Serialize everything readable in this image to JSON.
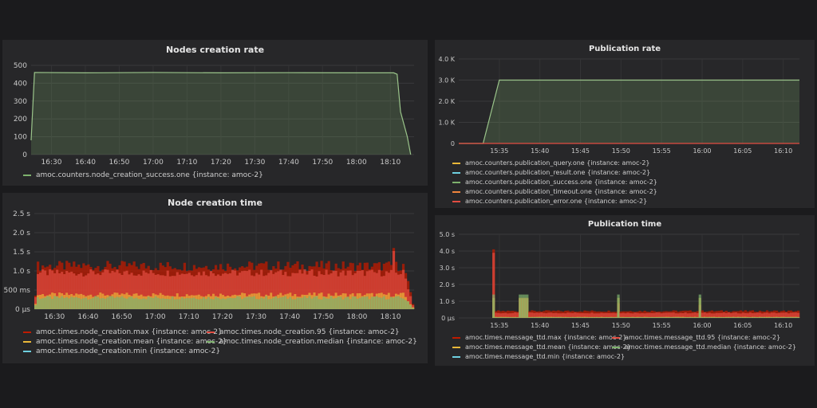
{
  "panels": {
    "p1": {
      "title": "Nodes creation rate",
      "legend": [
        {
          "label": "amoc.counters.node_creation_success.one {instance: amoc-2}",
          "color": "#7eb26d"
        }
      ]
    },
    "p2": {
      "title": "Node creation time",
      "legend": [
        {
          "label": "amoc.times.node_creation.max {instance: amoc-2}",
          "color": "#bf1b00"
        },
        {
          "label": "amoc.times.node_creation.95 {instance: amoc-2}",
          "color": "#e24d42"
        },
        {
          "label": "amoc.times.node_creation.mean {instance: amoc-2}",
          "color": "#eab839"
        },
        {
          "label": "amoc.times.node_creation.median {instance: amoc-2}",
          "color": "#7eb26d"
        },
        {
          "label": "amoc.times.node_creation.min {instance: amoc-2}",
          "color": "#6ed0e0"
        }
      ]
    },
    "p3": {
      "title": "Publication rate",
      "legend": [
        {
          "label": "amoc.counters.publication_query.one {instance: amoc-2}",
          "color": "#eab839"
        },
        {
          "label": "amoc.counters.publication_result.one {instance: amoc-2}",
          "color": "#6ed0e0"
        },
        {
          "label": "amoc.counters.publication_success.one {instance: amoc-2}",
          "color": "#7eb26d"
        },
        {
          "label": "amoc.counters.publication_timeout.one {instance: amoc-2}",
          "color": "#ef843c"
        },
        {
          "label": "amoc.counters.publication_error.one {instance: amoc-2}",
          "color": "#e24d42"
        }
      ]
    },
    "p4": {
      "title": "Publication time",
      "legend": [
        {
          "label": "amoc.times.message_ttd.max {instance: amoc-2}",
          "color": "#bf1b00"
        },
        {
          "label": "amoc.times.message_ttd.95 {instance: amoc-2}",
          "color": "#e24d42"
        },
        {
          "label": "amoc.times.message_ttd.mean {instance: amoc-2}",
          "color": "#eab839"
        },
        {
          "label": "amoc.times.message_ttd.median {instance: amoc-2}",
          "color": "#7eb26d"
        },
        {
          "label": "amoc.times.message_ttd.min {instance: amoc-2}",
          "color": "#6ed0e0"
        }
      ]
    }
  },
  "chart_data": [
    {
      "id": "p1",
      "type": "area",
      "title": "Nodes creation rate",
      "x_ticks": [
        "16:30",
        "16:40",
        "16:50",
        "17:00",
        "17:10",
        "17:20",
        "17:30",
        "17:40",
        "17:50",
        "18:00",
        "18:10"
      ],
      "xlim": [
        "16:24",
        "18:17"
      ],
      "y_ticks": [
        "500",
        "400",
        "300",
        "200",
        "100",
        "0"
      ],
      "ylim": [
        0,
        500
      ],
      "grid": true,
      "series": [
        {
          "name": "amoc.counters.node_creation_success.one {instance: amoc-2}",
          "x": [
            "16:24",
            "16:25",
            "16:40",
            "17:00",
            "17:20",
            "17:40",
            "18:00",
            "18:11",
            "18:12",
            "18:13",
            "18:15",
            "18:16"
          ],
          "values": [
            80,
            460,
            458,
            460,
            458,
            459,
            458,
            458,
            450,
            240,
            100,
            0
          ]
        }
      ]
    },
    {
      "id": "p2",
      "type": "bar",
      "title": "Node creation time",
      "x_ticks": [
        "16:30",
        "16:40",
        "16:50",
        "17:00",
        "17:10",
        "17:20",
        "17:30",
        "17:40",
        "17:50",
        "18:00",
        "18:10"
      ],
      "xlim": [
        "16:24",
        "18:17"
      ],
      "y_ticks": [
        "2.5 s",
        "2.0 s",
        "1.5 s",
        "1.0 s",
        "500 ms",
        "0 µs"
      ],
      "ylim": [
        0,
        2.5
      ],
      "grid": true,
      "typical": {
        "max": 1.1,
        "p95": 0.95,
        "mean": 0.38,
        "median": 0.3,
        "min": 0.0
      },
      "spikes": [
        {
          "x": "16:25",
          "max": 2.1
        },
        {
          "x": "18:11",
          "max": 1.6
        }
      ]
    },
    {
      "id": "p3",
      "type": "area",
      "title": "Publication rate",
      "x_ticks": [
        "15:35",
        "15:40",
        "15:45",
        "15:50",
        "15:55",
        "16:00",
        "16:05",
        "16:10"
      ],
      "xlim": [
        "15:30",
        "16:12"
      ],
      "y_ticks": [
        "4.0 K",
        "3.0 K",
        "2.0 K",
        "1.0 K",
        "0"
      ],
      "ylim": [
        0,
        4000
      ],
      "grid": true,
      "series": [
        {
          "name": "amoc.counters.publication_success.one {instance: amoc-2}",
          "x": [
            "15:30",
            "15:33",
            "15:34",
            "15:35",
            "15:40",
            "15:50",
            "16:00",
            "16:12"
          ],
          "values": [
            0,
            0,
            1500,
            3000,
            3000,
            3000,
            3000,
            3000
          ]
        }
      ]
    },
    {
      "id": "p4",
      "type": "bar",
      "title": "Publication time",
      "x_ticks": [
        "15:35",
        "15:40",
        "15:45",
        "15:50",
        "15:55",
        "16:00",
        "16:05",
        "16:10"
      ],
      "xlim": [
        "15:30",
        "16:12"
      ],
      "y_ticks": [
        "5.0 s",
        "4.0 s",
        "3.0 s",
        "2.0 s",
        "1.0 s",
        "0 µs"
      ],
      "ylim": [
        0,
        5
      ],
      "grid": true,
      "typical": {
        "max": 0.4,
        "p95": 0.3,
        "mean": 0.06,
        "median": 0.05,
        "min": 0.0
      },
      "spikes": [
        {
          "x": "15:34",
          "max": 4.1
        },
        {
          "x": "15:34",
          "max": 4.1
        },
        {
          "x": "15:38",
          "max": 1.2
        },
        {
          "x": "15:50",
          "max": 0.9
        },
        {
          "x": "16:00",
          "max": 0.8
        }
      ]
    }
  ]
}
